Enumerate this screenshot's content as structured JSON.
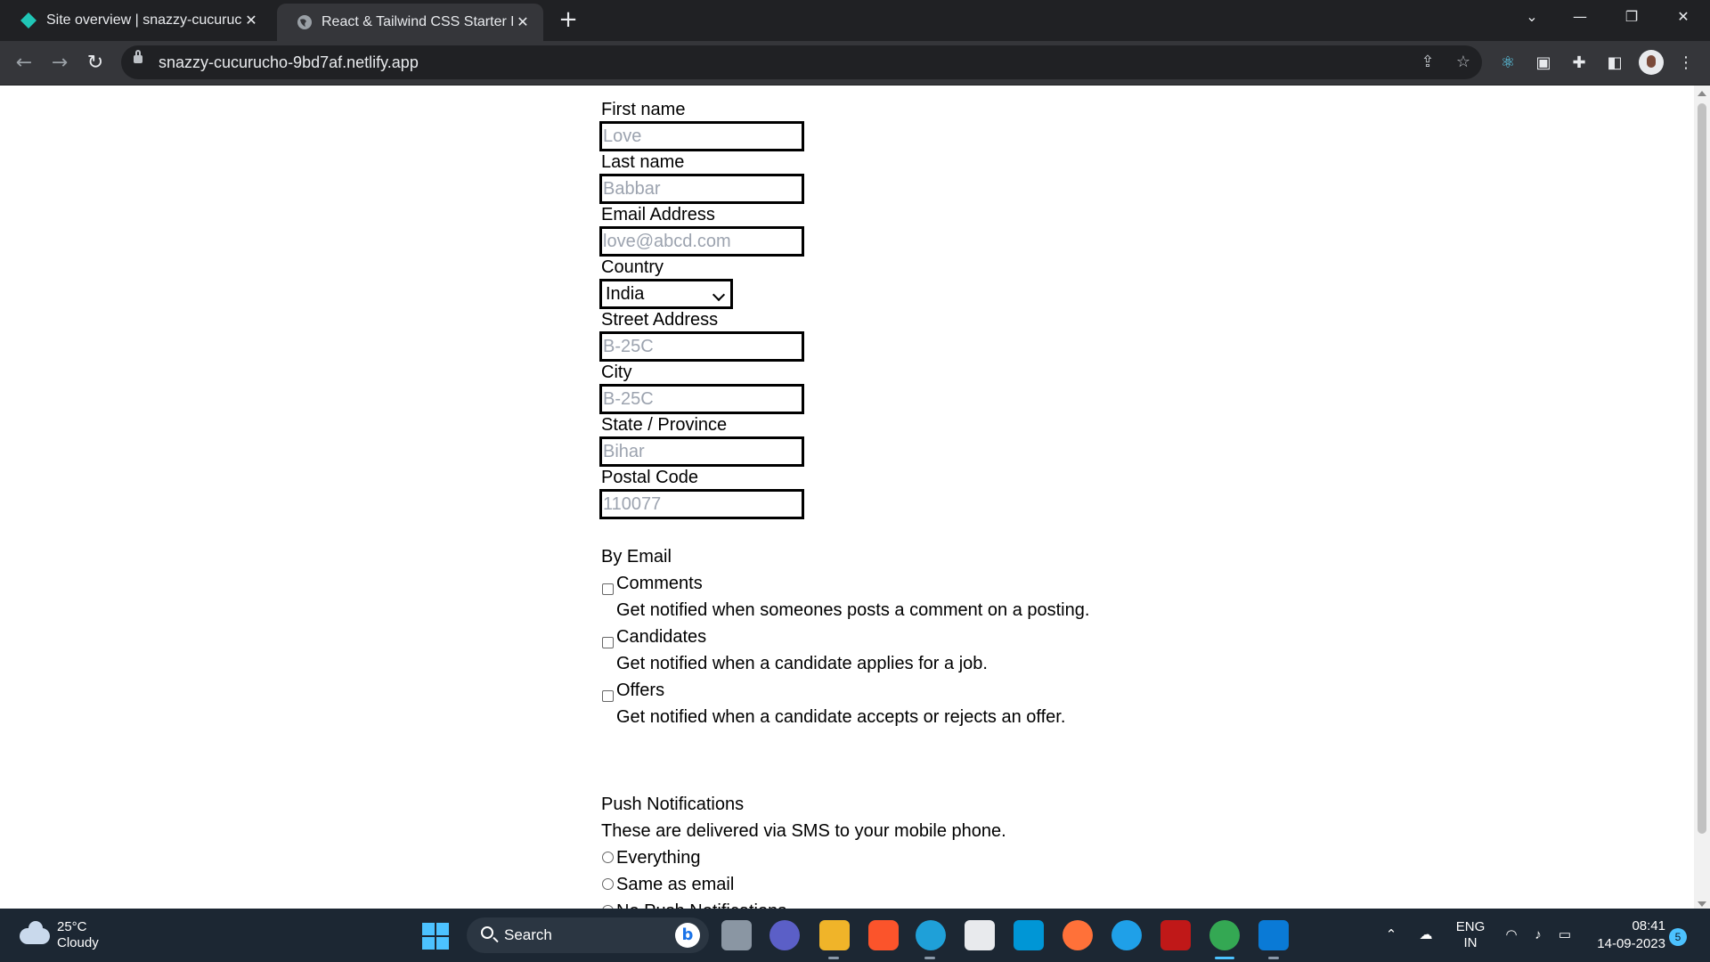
{
  "browser": {
    "tabs": [
      {
        "title": "Site overview | snazzy-cucurucho",
        "active": false
      },
      {
        "title": "React & Tailwind CSS Starter Pack",
        "active": true
      }
    ],
    "new_tab_symbol": "+",
    "url": "snazzy-cucurucho-9bd7af.netlify.app",
    "icons": [
      "back-icon",
      "forward-icon",
      "reload-icon",
      "lock-icon",
      "share-icon",
      "star-icon",
      "react-devtools-icon",
      "media-icon",
      "extensions-icon",
      "sidepanel-icon",
      "avatar",
      "menu-icon"
    ]
  },
  "form": {
    "first_name": {
      "label": "First name",
      "placeholder": "Love"
    },
    "last_name": {
      "label": "Last name",
      "placeholder": "Babbar"
    },
    "email": {
      "label": "Email Address",
      "placeholder": "love@abcd.com"
    },
    "country": {
      "label": "Country",
      "value": "India"
    },
    "street": {
      "label": "Street Address",
      "placeholder": "B-25C"
    },
    "city": {
      "label": "City",
      "placeholder": "B-25C"
    },
    "state": {
      "label": "State / Province",
      "placeholder": "Bihar"
    },
    "postal": {
      "label": "Postal Code",
      "placeholder": "110077"
    },
    "by_email": {
      "title": "By Email",
      "options": [
        {
          "label": "Comments",
          "description": "Get notified when someones posts a comment on a posting."
        },
        {
          "label": "Candidates",
          "description": "Get notified when a candidate applies for a job."
        },
        {
          "label": "Offers",
          "description": "Get notified when a candidate accepts or rejects an offer."
        }
      ]
    },
    "push": {
      "title": "Push Notifications",
      "description": "These are delivered via SMS to your mobile phone.",
      "options": [
        "Everything",
        "Same as email",
        "No Push Notifications"
      ]
    }
  },
  "taskbar": {
    "weather": {
      "temp": "25°C",
      "desc": "Cloudy"
    },
    "search_label": "Search",
    "language": {
      "line1": "ENG",
      "line2": "IN"
    },
    "time": "08:41",
    "date": "14-09-2023",
    "notification_count": "5",
    "colors": {
      "accent": "#4cc2ff",
      "taskbar_bg": "#1c2733"
    }
  }
}
